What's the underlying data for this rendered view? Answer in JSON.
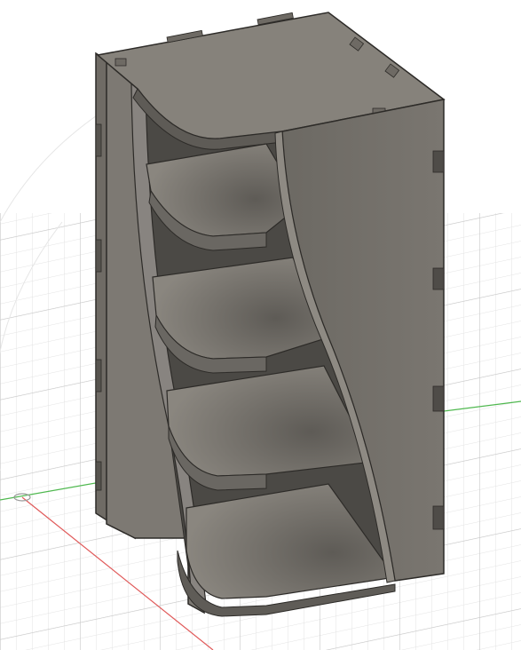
{
  "app": {
    "name": ""
  },
  "viewport": {
    "background": "#ffffff",
    "grid": {
      "shown": true,
      "minor_color": "#e3e3e3",
      "major_color": "#c9c9c9"
    },
    "axes": {
      "x_axis_color": "#e05a5a",
      "y_axis_color": "#4fb84f"
    }
  },
  "model": {
    "type": "laser-cut shelf unit",
    "shelf_count": 4,
    "finger_joints": true,
    "colors": {
      "face_light": "#8e8a83",
      "face_mid": "#6f6b65",
      "face_dark": "#5a5752",
      "edge": "#2d2b28",
      "inner_shadow": "#3b3936"
    }
  }
}
